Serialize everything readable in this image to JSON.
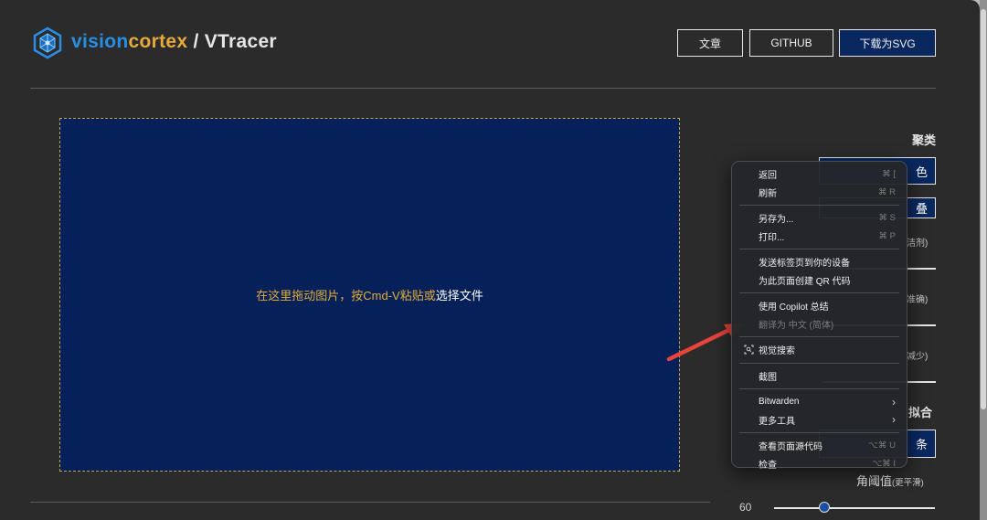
{
  "header": {
    "brand_part1": "vision",
    "brand_part2": "cortex",
    "brand_part3": " / VTracer",
    "nav": {
      "articles": "文章",
      "github": "GITHUB",
      "download_svg": "下载为SVG"
    }
  },
  "dropzone": {
    "text_prefix": "在这里拖动图片，按Cmd-V粘贴或",
    "text_link": "选择文件"
  },
  "panel": {
    "clustering_label": "聚类",
    "color_button_partial": "色",
    "stacked_button_partial": "叠",
    "hint_1": "洁剂)",
    "hint_2": "准确)",
    "hint_3": "减少)",
    "curve_fit_partial": "拟合",
    "spline_button_partial": "条",
    "corner_threshold_label": "角阈值",
    "corner_threshold_hint": "(更平滑)",
    "corner_threshold_value": "60",
    "corner_threshold_fraction": 0.31
  },
  "context_menu": {
    "back": {
      "label": "返回",
      "shortcut": "⌘ ["
    },
    "refresh": {
      "label": "刷新",
      "shortcut": "⌘ R"
    },
    "save_as": {
      "label": "另存为...",
      "shortcut": "⌘ S"
    },
    "print": {
      "label": "打印...",
      "shortcut": "⌘ P"
    },
    "send_tab": {
      "label": "发送标签页到你的设备"
    },
    "qr_code": {
      "label": "为此页面创建 QR 代码"
    },
    "copilot": {
      "label": "使用 Copilot 总结"
    },
    "translate": {
      "label": "翻译为 中文 (简体)"
    },
    "visual_search": {
      "label": "视觉搜索"
    },
    "screenshot": {
      "label": "截图"
    },
    "bitwarden": {
      "label": "Bitwarden"
    },
    "more_tools": {
      "label": "更多工具"
    },
    "view_source": {
      "label": "查看页面源代码",
      "shortcut": "⌥⌘ U"
    },
    "inspect": {
      "label": "检查",
      "shortcut": "⌥⌘ I"
    }
  },
  "colors": {
    "window_bg": "#2b2b2b",
    "accent_navy": "#06215a",
    "brand_blue": "#2a8de4",
    "brand_orange": "#e8a93b",
    "arrow_red": "#e8443a"
  }
}
